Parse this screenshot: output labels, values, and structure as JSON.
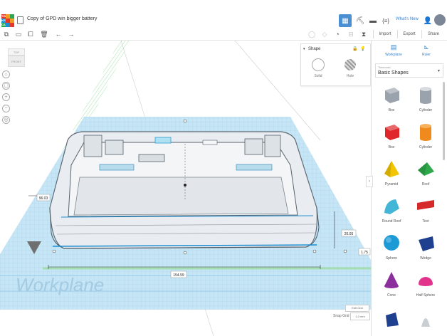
{
  "app": {
    "name": "Tinkercad"
  },
  "header": {
    "logo_letters": [
      "TIN",
      "KER",
      "CAD"
    ],
    "title": "Copy of GPD win bigger battery",
    "whats_new": "What's New"
  },
  "toolbar": {
    "import_label": "Import",
    "export_label": "Export",
    "share_label": "Share"
  },
  "viewcube": {
    "top": "TOP",
    "front": "FRONT"
  },
  "shape_panel": {
    "title": "Shape",
    "solid_label": "Solid",
    "hole_label": "Hole"
  },
  "dimensions": {
    "width": "154.59",
    "depth": "96.03",
    "height": "20.05",
    "elevation": "1.75"
  },
  "workplane_label": "Workplane",
  "grid": {
    "edit_label": "Edit Grid",
    "snap_label": "Snap Grid",
    "snap_value": "1.0 mm"
  },
  "right_panel": {
    "workplane_label": "Workplane",
    "ruler_label": "Ruler",
    "library_category": "Tinkercad",
    "library_name": "Basic Shapes"
  },
  "shapes": [
    {
      "label": "Box",
      "color": "#9aa2ad"
    },
    {
      "label": "Cylinder",
      "color": "#9aa2ad"
    },
    {
      "label": "Box",
      "color": "#e0262a"
    },
    {
      "label": "Cylinder",
      "color": "#f08a1c"
    },
    {
      "label": "Pyramid",
      "color": "#f2c500"
    },
    {
      "label": "Roof",
      "color": "#2ea84a"
    },
    {
      "label": "Round Roof",
      "color": "#43b5d6"
    },
    {
      "label": "Text",
      "color": "#d62a2a"
    },
    {
      "label": "Sphere",
      "color": "#1b9ad6"
    },
    {
      "label": "Wedge",
      "color": "#1f3f8f"
    },
    {
      "label": "Cone",
      "color": "#8a2f9b"
    },
    {
      "label": "Half Sphere",
      "color": "#e2338c"
    }
  ],
  "colors": {
    "accent": "#3a84d6",
    "grid_blue": "#a7d3ec",
    "axis_green": "#7fd68a"
  }
}
